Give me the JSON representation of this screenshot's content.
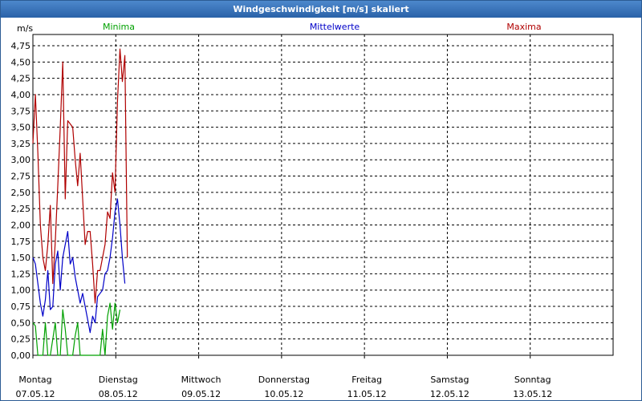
{
  "window": {
    "title": "Windgeschwindigkeit [m/s] skaliert"
  },
  "legend": [
    {
      "label": "Minima",
      "color": "#00a000"
    },
    {
      "label": "Mittelwerte",
      "color": "#0000c8"
    },
    {
      "label": "Maxima",
      "color": "#b00000"
    }
  ],
  "chart_data": {
    "type": "line",
    "title": "Windgeschwindigkeit [m/s] skaliert",
    "ylabel": "m/s",
    "xlabel": "",
    "ylim": [
      0,
      4.75
    ],
    "yticks": [
      "0,00",
      "0,25",
      "0,50",
      "0,75",
      "1,00",
      "1,25",
      "1,50",
      "1,75",
      "2,00",
      "2,25",
      "2,50",
      "2,75",
      "3,00",
      "3,25",
      "3,50",
      "3,75",
      "4,00",
      "4,25",
      "4,50",
      "4,75"
    ],
    "days": [
      {
        "name": "Montag",
        "date": "07.05.12"
      },
      {
        "name": "Dienstag",
        "date": "08.05.12"
      },
      {
        "name": "Mittwoch",
        "date": "09.05.12"
      },
      {
        "name": "Donnerstag",
        "date": "10.05.12"
      },
      {
        "name": "Freitag",
        "date": "11.05.12"
      },
      {
        "name": "Samstag",
        "date": "12.05.12"
      },
      {
        "name": "Sonntag",
        "date": "13.05.12"
      }
    ],
    "x_unit": "days since Montag 07.05.12 00:00",
    "grid": true,
    "series": [
      {
        "name": "Maxima",
        "color": "#b00000",
        "x": [
          0.0,
          0.03,
          0.06,
          0.09,
          0.12,
          0.15,
          0.18,
          0.21,
          0.24,
          0.27,
          0.3,
          0.33,
          0.36,
          0.39,
          0.42,
          0.45,
          0.48,
          0.51,
          0.54,
          0.57,
          0.6,
          0.63,
          0.66,
          0.69,
          0.72,
          0.75,
          0.78,
          0.81,
          0.84,
          0.87,
          0.9,
          0.93,
          0.96,
          0.99,
          1.02,
          1.05,
          1.08,
          1.11,
          1.14,
          1.17,
          1.2,
          1.23,
          1.26,
          1.29,
          1.32,
          1.35,
          1.38,
          1.41,
          1.44,
          1.47,
          1.5
        ],
        "values": [
          3.25,
          4.0,
          3.1,
          2.0,
          1.5,
          1.3,
          1.7,
          2.3,
          1.1,
          1.75,
          2.6,
          3.5,
          4.5,
          2.4,
          3.6,
          3.55,
          3.5,
          3.0,
          2.6,
          3.1,
          2.4,
          1.7,
          1.9,
          1.9,
          1.4,
          0.8,
          1.3,
          1.3,
          1.5,
          1.7,
          2.2,
          2.1,
          2.8,
          2.5,
          3.9,
          4.7,
          4.2,
          4.6,
          1.5,
          null,
          null,
          null,
          null,
          null,
          null,
          null,
          null,
          null,
          null,
          null,
          null
        ]
      },
      {
        "name": "Mittelwerte",
        "color": "#0000c8",
        "x": [
          0.0,
          0.03,
          0.06,
          0.09,
          0.12,
          0.15,
          0.18,
          0.21,
          0.24,
          0.27,
          0.3,
          0.33,
          0.36,
          0.39,
          0.42,
          0.45,
          0.48,
          0.51,
          0.54,
          0.57,
          0.6,
          0.63,
          0.66,
          0.69,
          0.72,
          0.75,
          0.78,
          0.81,
          0.84,
          0.87,
          0.9,
          0.93,
          0.96,
          0.99,
          1.02,
          1.05,
          1.08,
          1.11,
          1.14,
          1.17,
          1.2,
          1.23,
          1.26,
          1.29,
          1.32,
          1.35,
          1.38,
          1.41,
          1.44,
          1.47,
          1.5
        ],
        "values": [
          1.5,
          1.4,
          1.1,
          0.8,
          0.6,
          0.85,
          1.3,
          0.7,
          0.75,
          1.4,
          1.6,
          1.0,
          1.5,
          1.7,
          1.9,
          1.4,
          1.5,
          1.2,
          1.0,
          0.8,
          0.95,
          0.75,
          0.55,
          0.35,
          0.6,
          0.5,
          0.9,
          0.95,
          1.0,
          1.25,
          1.3,
          1.5,
          1.8,
          2.2,
          2.4,
          2.0,
          1.5,
          1.1,
          null,
          null,
          null,
          null,
          null,
          null,
          null,
          null,
          null,
          null,
          null,
          null,
          null
        ]
      },
      {
        "name": "Minima",
        "color": "#00a000",
        "x": [
          0.0,
          0.03,
          0.06,
          0.09,
          0.12,
          0.15,
          0.18,
          0.21,
          0.24,
          0.27,
          0.3,
          0.33,
          0.36,
          0.39,
          0.42,
          0.45,
          0.48,
          0.51,
          0.54,
          0.57,
          0.6,
          0.63,
          0.66,
          0.69,
          0.72,
          0.75,
          0.78,
          0.81,
          0.84,
          0.87,
          0.9,
          0.93,
          0.96,
          0.99,
          1.02,
          1.05,
          1.08,
          1.11,
          1.14,
          1.17,
          1.2,
          1.23,
          1.26,
          1.29,
          1.32,
          1.35,
          1.38,
          1.41,
          1.44,
          1.47,
          1.5
        ],
        "values": [
          0.5,
          0.45,
          0.0,
          0.0,
          0.0,
          0.5,
          0.0,
          0.0,
          0.25,
          0.5,
          0.0,
          0.0,
          0.7,
          0.4,
          0.0,
          0.0,
          0.0,
          0.3,
          0.5,
          0.0,
          0.0,
          0.0,
          0.0,
          0.0,
          0.0,
          0.0,
          0.0,
          0.0,
          0.4,
          0.0,
          0.6,
          0.8,
          0.4,
          0.8,
          0.5,
          0.7,
          null,
          null,
          null,
          null,
          null,
          null,
          null,
          null,
          null,
          null,
          null,
          null,
          null,
          null,
          null
        ]
      }
    ]
  }
}
